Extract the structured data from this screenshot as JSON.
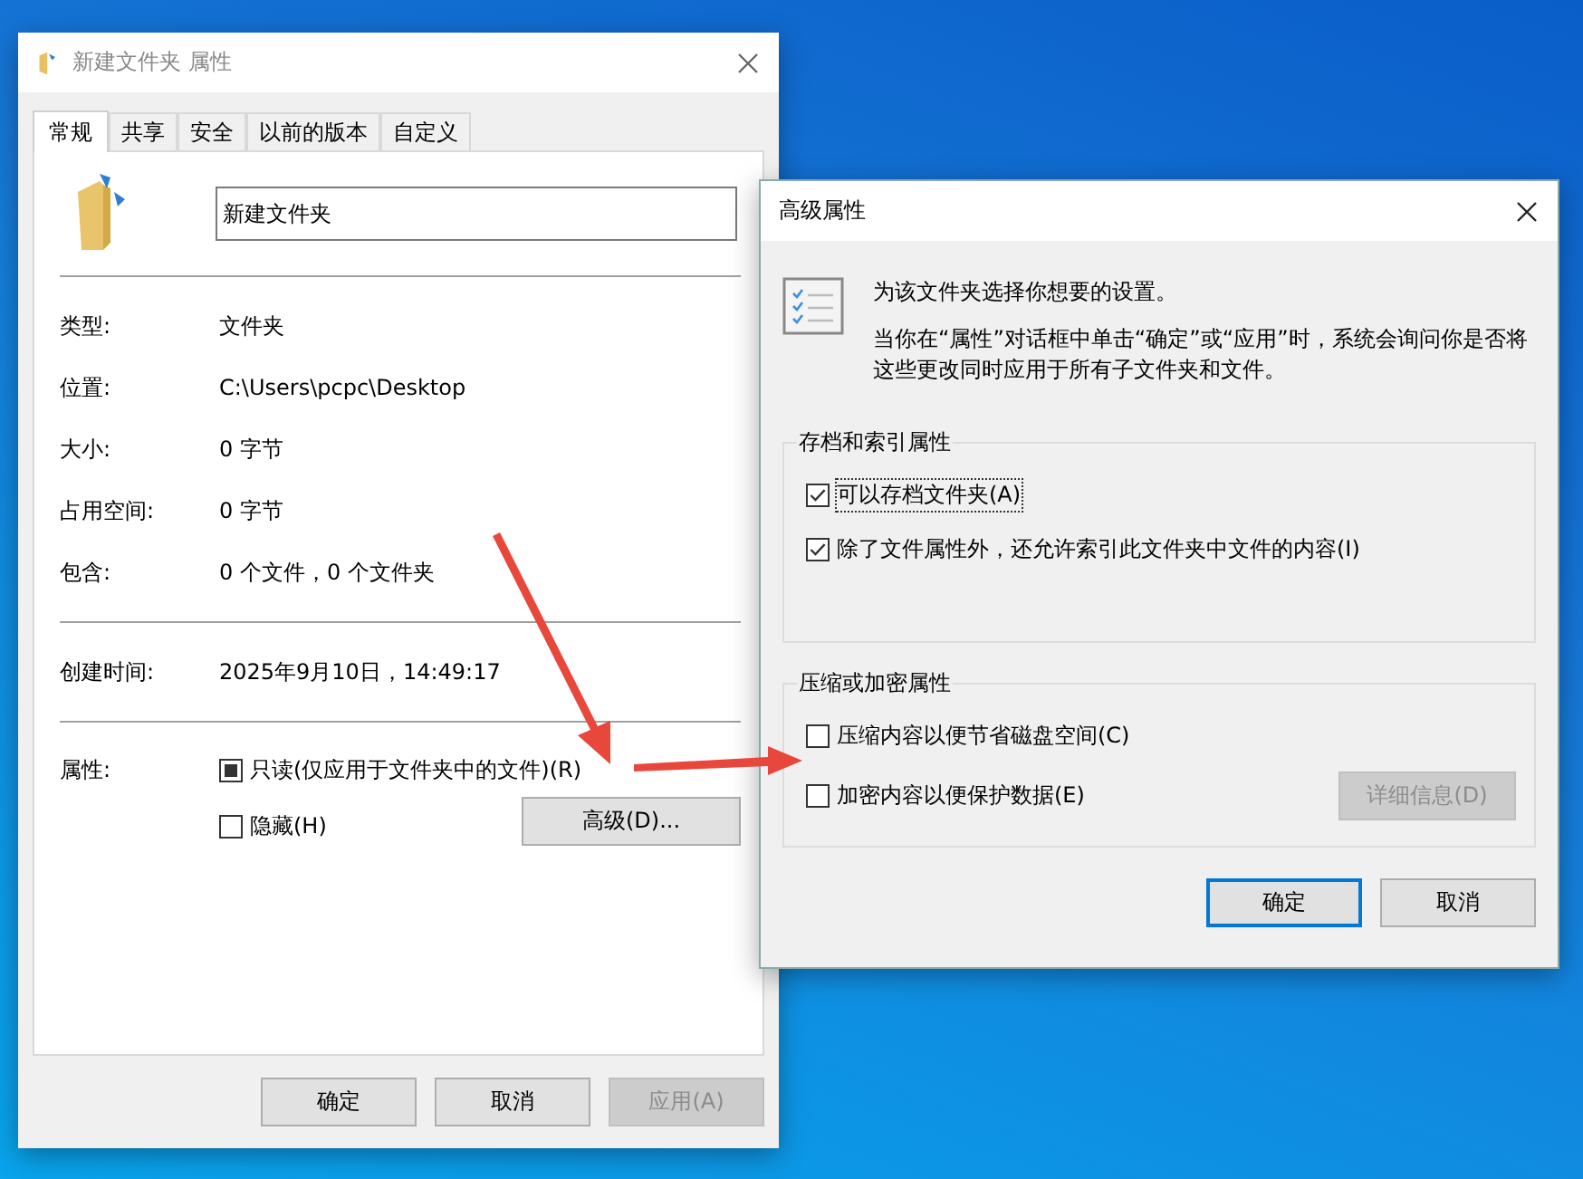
{
  "properties_window": {
    "title": "新建文件夹 属性",
    "tabs": [
      {
        "label": "常规",
        "selected": true
      },
      {
        "label": "共享",
        "selected": false
      },
      {
        "label": "安全",
        "selected": false
      },
      {
        "label": "以前的版本",
        "selected": false
      },
      {
        "label": "自定义",
        "selected": false
      }
    ],
    "folder_name": "新建文件夹",
    "info_sections": [
      {
        "rows": [
          {
            "label": "类型:",
            "value": "文件夹"
          },
          {
            "label": "位置:",
            "value": "C:\\Users\\pcpc\\Desktop"
          },
          {
            "label": "大小:",
            "value": "0 字节"
          },
          {
            "label": "占用空间:",
            "value": "0 字节"
          },
          {
            "label": "包含:",
            "value": "0 个文件，0 个文件夹"
          }
        ]
      },
      {
        "rows": [
          {
            "label": "创建时间:",
            "value": "2025年9月10日，14:49:17"
          }
        ]
      }
    ],
    "attributes": {
      "label": "属性:",
      "options": [
        {
          "label": "只读(仅应用于文件夹中的文件)(R)",
          "checked": false,
          "indeterminate": true
        },
        {
          "label": "隐藏(H)",
          "checked": false,
          "indeterminate": false
        }
      ],
      "advanced_button": "高级(D)..."
    },
    "buttons": [
      {
        "label": "确定",
        "disabled": false
      },
      {
        "label": "取消",
        "disabled": false
      },
      {
        "label": "应用(A)",
        "disabled": true
      }
    ]
  },
  "advanced_window": {
    "title": "高级属性",
    "intro": "为该文件夹选择你想要的设置。",
    "note": "当你在“属性”对话框中单击“确定”或“应用”时，系统会询问你是否将这些更改同时应用于所有子文件夹和文件。",
    "groups": [
      {
        "title": "存档和索引属性",
        "options": [
          {
            "label": "可以存档文件夹(A)",
            "checked": true,
            "focused": true
          },
          {
            "label": "除了文件属性外，还允许索引此文件夹中文件的内容(I)",
            "checked": true,
            "focused": false
          }
        ]
      },
      {
        "title": "压缩或加密属性",
        "options": [
          {
            "label": "压缩内容以便节省磁盘空间(C)",
            "checked": false,
            "focused": false
          },
          {
            "label": "加密内容以便保护数据(E)",
            "checked": false,
            "focused": false
          }
        ],
        "button": {
          "label": "详细信息(D)",
          "disabled": true
        }
      }
    ],
    "buttons": [
      {
        "label": "确定",
        "default": true
      },
      {
        "label": "取消",
        "default": false
      }
    ]
  }
}
